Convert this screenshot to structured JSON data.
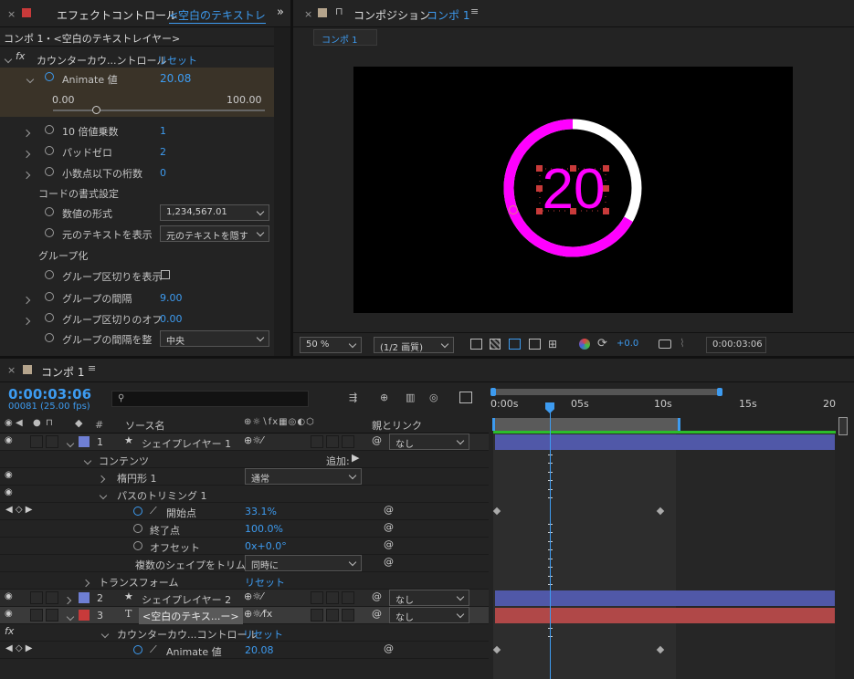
{
  "effects_panel": {
    "tab_title": "エフェクトコントロール",
    "tab_target": "<空白のテキストレ",
    "breadcrumb": "コンポ 1・<空白のテキストレイヤー>",
    "fx_label": "fx",
    "effect_name": "カウンターカウ...ントロール",
    "reset": "リセット",
    "animate_label": "Animate 値",
    "animate_value": "20.08",
    "slider_min": "0.00",
    "slider_max": "100.00",
    "slider_fraction": 0.2008,
    "props": [
      {
        "label": "10 倍値乗数",
        "value": "1"
      },
      {
        "label": "パッドゼロ",
        "value": "2"
      },
      {
        "label": "小数点以下の桁数",
        "value": "0"
      }
    ],
    "code_format_header": "コードの書式設定",
    "number_format_label": "数値の形式",
    "number_format_value": "1,234,567.01",
    "show_original_label": "元のテキストを表示",
    "show_original_value": "元のテキストを隠す",
    "group_header": "グループ化",
    "group_sep_show_label": "グループ区切りを表示",
    "group_spacing_label": "グループの間隔",
    "group_spacing_value": "9.00",
    "group_sep_offset_label": "グループ区切りのオフ",
    "group_sep_offset_value": "0.00",
    "group_align_label": "グループの間隔を整",
    "group_align_value": "中央"
  },
  "comp_panel": {
    "tab_title": "コンポジション",
    "tab_comp": "コンポ 1",
    "subtab": "コンポ 1",
    "counter_text": "20",
    "ring_fraction": 0.331,
    "ring_color": "#ff00ff",
    "zoom": "50 %",
    "resolution": "(1/2 画質)",
    "exposure": "+0.0",
    "timecode": "0:00:03:06"
  },
  "timeline": {
    "tab_title": "コンポ 1",
    "timecode": "0:00:03:06",
    "frames": "00081 (25.00 fps)",
    "search_placeholder": "",
    "ruler": [
      "0:00s",
      "05s",
      "10s",
      "15s",
      "20"
    ],
    "col_source": "ソース名",
    "col_parent": "親とリンク",
    "add_label": "追加:",
    "none": "なし",
    "layers": [
      {
        "num": "1",
        "name": "シェイプレイヤー 1",
        "color": "#6f7fd4"
      },
      {
        "num": "2",
        "name": "シェイプレイヤー 2",
        "color": "#6f7fd4"
      },
      {
        "num": "3",
        "name": "<空白のテキス...ー>",
        "color": "#c83a3a"
      }
    ],
    "contents": "コンテンツ",
    "ellipse": "楕円形 1",
    "ellipse_mode": "通常",
    "trim": "パスのトリミング 1",
    "start_label": "開始点",
    "start_value": "33.1%",
    "end_label": "終了点",
    "end_value": "100.0%",
    "offset_label": "オフセット",
    "offset_value": "0x+0.0°",
    "trim_multi_label": "複数のシェイプをトリム",
    "trim_multi_value": "同時に",
    "transform": "トランスフォーム",
    "reset": "リセット",
    "effect_name": "カウンターカウ...コントロール",
    "animate_label": "Animate 値",
    "animate_value": "20.08"
  }
}
